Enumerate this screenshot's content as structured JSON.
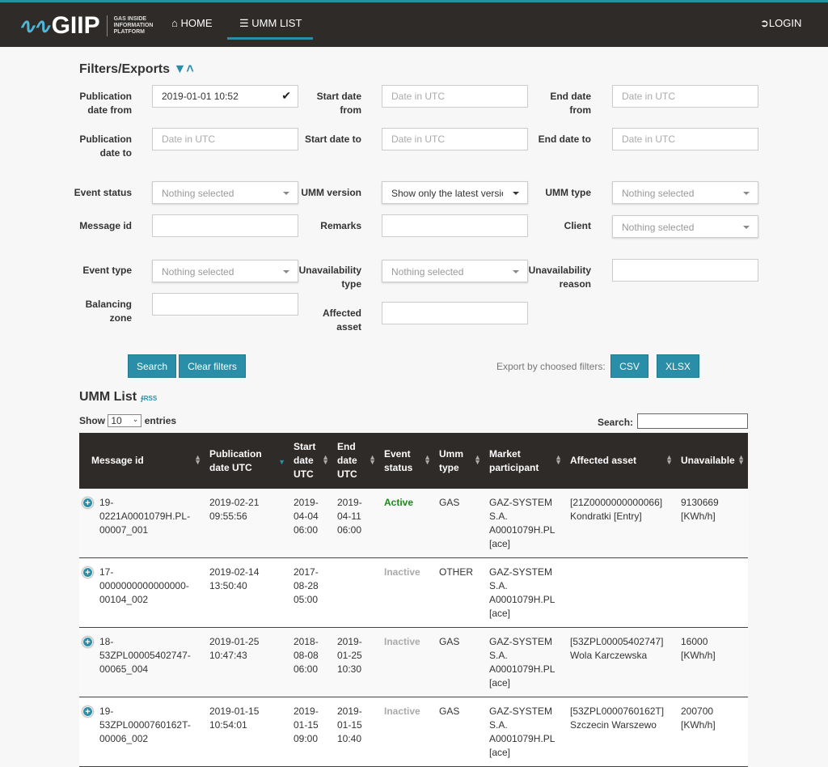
{
  "header": {
    "logo_text": "GIIP",
    "logo_tagline": [
      "GAS INSIDE",
      "INFORMATION",
      "PLATFORM"
    ],
    "nav": [
      {
        "label": "HOME",
        "icon": "home-icon"
      },
      {
        "label": "UMM LIST",
        "icon": "list-icon",
        "active": true
      }
    ],
    "login": "LOGIN"
  },
  "filters": {
    "title": "Filters/Exports",
    "pub_from": {
      "label1": "Publication",
      "label2": "date from",
      "value": "2019-01-01 10:52"
    },
    "start_from": {
      "label1": "Start date",
      "label2": "from",
      "placeholder": "Date in UTC"
    },
    "end_from": {
      "label1": "End date",
      "label2": "from",
      "placeholder": "Date in UTC"
    },
    "pub_to": {
      "label1": "Publication",
      "label2": "date to",
      "placeholder": "Date in UTC"
    },
    "start_to": {
      "label": "Start date to",
      "placeholder": "Date in UTC"
    },
    "end_to": {
      "label": "End date to",
      "placeholder": "Date in UTC"
    },
    "event_status": {
      "label": "Event status",
      "value": "Nothing selected"
    },
    "umm_version": {
      "label": "UMM version",
      "value": "Show only the latest version"
    },
    "umm_type": {
      "label": "UMM type",
      "value": "Nothing selected"
    },
    "message_id": {
      "label": "Message id"
    },
    "remarks": {
      "label": "Remarks"
    },
    "client": {
      "label": "Client",
      "value": "Nothing selected"
    },
    "event_type": {
      "label": "Event type",
      "value": "Nothing selected"
    },
    "unav_type": {
      "label1": "Unavailability",
      "label2": "type",
      "value": "Nothing selected"
    },
    "unav_reason": {
      "label1": "Unavailability",
      "label2": "reason"
    },
    "balancing_zone": {
      "label1": "Balancing",
      "label2": "zone"
    },
    "affected_asset": {
      "label1": "Affected",
      "label2": "asset"
    },
    "search": "Search",
    "clear": "Clear filters",
    "export_label": "Export by choosed filters:",
    "csv": "CSV",
    "xlsx": "XLSX"
  },
  "list": {
    "title": "UMM List",
    "rss": "RSS",
    "show": "Show",
    "entries_value": "10",
    "entries": "entries",
    "search_label": "Search:",
    "columns": [
      [
        "Message id"
      ],
      [
        "Publication",
        "date UTC"
      ],
      [
        "Start",
        "date",
        "UTC"
      ],
      [
        "End",
        "date",
        "UTC"
      ],
      [
        "Event",
        "status"
      ],
      [
        "Umm",
        "type"
      ],
      [
        "Market",
        "participant"
      ],
      [
        "Affected asset"
      ],
      [
        "Unavailable"
      ]
    ],
    "rows": [
      {
        "id": [
          "19-",
          "0221A0001079H.PL-",
          "00007_001"
        ],
        "pub": [
          "2019-02-21",
          "09:55:56"
        ],
        "start": [
          "2019-",
          "04-04",
          "06:00"
        ],
        "end": [
          "2019-",
          "04-11",
          "06:00"
        ],
        "status": "Active",
        "type": "GAS",
        "participant": [
          "GAZ-SYSTEM",
          "S.A.",
          "A0001079H.PL",
          "[ace]"
        ],
        "asset": [
          "[21Z0000000000066]",
          "Kondratki [Entry]"
        ],
        "unavailable": [
          "9130669",
          "[KWh/h]"
        ]
      },
      {
        "id": [
          "17-",
          "0000000000000000-",
          "00104_002"
        ],
        "pub": [
          "2019-02-14",
          "13:50:40"
        ],
        "start": [
          "2017-",
          "08-28",
          "05:00"
        ],
        "end": [],
        "status": "Inactive",
        "type": "OTHER",
        "participant": [
          "GAZ-SYSTEM",
          "S.A.",
          "A0001079H.PL",
          "[ace]"
        ],
        "asset": [],
        "unavailable": []
      },
      {
        "id": [
          "18-",
          "53ZPL00005402747-",
          "00065_004"
        ],
        "pub": [
          "2019-01-25",
          "10:47:43"
        ],
        "start": [
          "2018-",
          "08-08",
          "06:00"
        ],
        "end": [
          "2019-",
          "01-25",
          "10:30"
        ],
        "status": "Inactive",
        "type": "GAS",
        "participant": [
          "GAZ-SYSTEM",
          "S.A.",
          "A0001079H.PL",
          "[ace]"
        ],
        "asset": [
          "[53ZPL00005402747]",
          "Wola Karczewska"
        ],
        "unavailable": [
          "16000",
          "[KWh/h]"
        ]
      },
      {
        "id": [
          "19-",
          "53ZPL0000760162T-",
          "00006_002"
        ],
        "pub": [
          "2019-01-15",
          "10:54:01"
        ],
        "start": [
          "2019-",
          "01-15",
          "09:00"
        ],
        "end": [
          "2019-",
          "01-15",
          "10:40"
        ],
        "status": "Inactive",
        "type": "GAS",
        "participant": [
          "GAZ-SYSTEM",
          "S.A.",
          "A0001079H.PL",
          "[ace]"
        ],
        "asset": [
          "[53ZPL0000760162T]",
          "Szczecin Warszewo"
        ],
        "unavailable": [
          "200700",
          "[KWh/h]"
        ]
      }
    ]
  },
  "colors": {
    "header": "#2f2b29",
    "accent": "#2a8ea8",
    "active": "#1a8a1a"
  }
}
